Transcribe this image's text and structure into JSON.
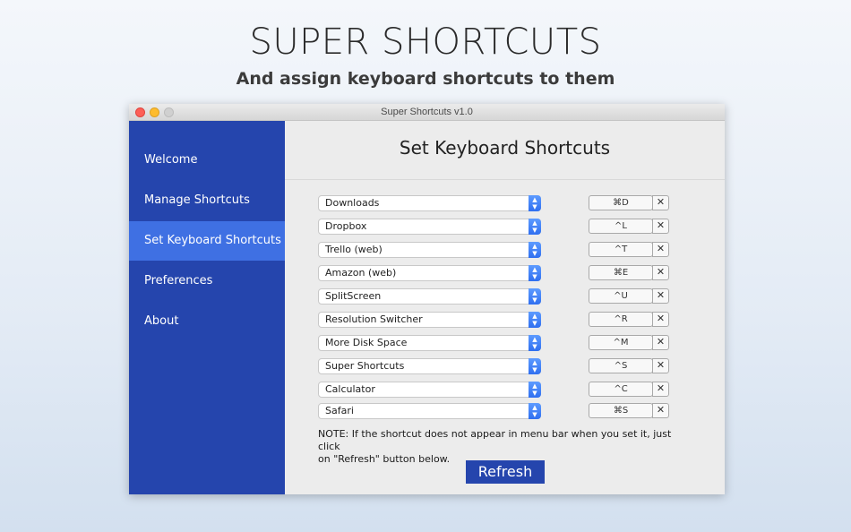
{
  "hero": {
    "title": "SUPER SHORTCUTS",
    "subtitle": "And assign keyboard shortcuts to them"
  },
  "window": {
    "title": "Super Shortcuts v1.0"
  },
  "sidebar": {
    "items": [
      {
        "label": "Welcome"
      },
      {
        "label": "Manage Shortcuts"
      },
      {
        "label": "Set Keyboard Shortcuts"
      },
      {
        "label": "Preferences"
      },
      {
        "label": "About"
      }
    ],
    "active_index": 2
  },
  "content": {
    "title": "Set Keyboard Shortcuts",
    "rows": [
      {
        "app": "Downloads",
        "shortcut": "⌘D"
      },
      {
        "app": "Dropbox",
        "shortcut": "^L"
      },
      {
        "app": "Trello (web)",
        "shortcut": "^T"
      },
      {
        "app": "Amazon (web)",
        "shortcut": "⌘E"
      },
      {
        "app": "SplitScreen",
        "shortcut": "^U"
      },
      {
        "app": "Resolution Switcher",
        "shortcut": "^R"
      },
      {
        "app": "More Disk Space",
        "shortcut": "^M"
      },
      {
        "app": "Super Shortcuts",
        "shortcut": "^S"
      },
      {
        "app": "Calculator",
        "shortcut": "^C"
      },
      {
        "app": "Safari",
        "shortcut": "⌘S"
      }
    ],
    "clear_symbol": "✕",
    "note_line1": "NOTE: If the shortcut does not appear in menu bar when you set it, just click",
    "note_line2": "on \"Refresh\" button below.",
    "refresh_label": "Refresh"
  },
  "colors": {
    "sidebar": "#2545ad",
    "sidebar_active": "#3f70e3",
    "button": "#2545ad"
  }
}
